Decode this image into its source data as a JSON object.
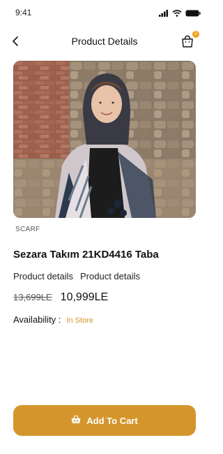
{
  "status_bar": {
    "time": "9:41"
  },
  "header": {
    "title": "Product Details",
    "cart_count": "2"
  },
  "product": {
    "category": "SCARF",
    "name": "Sezara Takım 21KD4416 Taba",
    "details": [
      "Product details",
      "Product details"
    ],
    "old_price": "13,699LE",
    "new_price": "10,999LE",
    "availability_label": "Availability :",
    "availability_value": "In Store"
  },
  "actions": {
    "add_to_cart_label": "Add To Cart"
  },
  "colors": {
    "accent": "#d4962c",
    "badge": "#f0a020"
  }
}
